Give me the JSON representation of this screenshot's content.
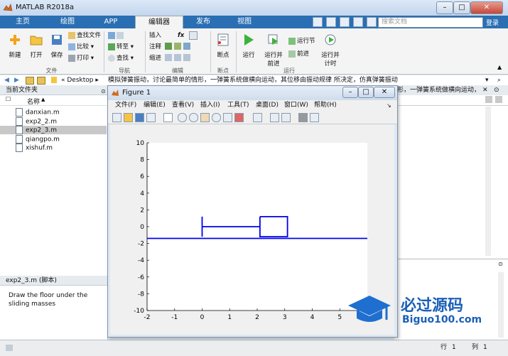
{
  "app": {
    "title": "MATLAB R2018a"
  },
  "tabs": [
    {
      "label": "主页"
    },
    {
      "label": "绘图"
    },
    {
      "label": "APP"
    },
    {
      "label": "编辑器"
    },
    {
      "label": "发布"
    },
    {
      "label": "视图"
    }
  ],
  "search": {
    "placeholder": "搜索文档"
  },
  "signin": "登录",
  "ribbon": {
    "file": {
      "new": "新建",
      "open": "打开",
      "save": "保存",
      "find_files": "查找文件",
      "compare": "比较",
      "print": "打印",
      "group": "文件"
    },
    "nav": {
      "goto": "转至",
      "find": "查找",
      "group": "导航"
    },
    "edit": {
      "insert": "插入",
      "comment": "注释",
      "indent": "缩进",
      "fx": "fx",
      "group": "编辑"
    },
    "breakpoints": {
      "label": "断点",
      "group": "断点"
    },
    "run": {
      "run": "运行",
      "run_advance_1": "运行并",
      "run_advance_2": "前进",
      "run_section": "运行节",
      "advance": "前进",
      "run_time_1": "运行并",
      "run_time_2": "计时",
      "group": "运行"
    }
  },
  "pathbar": {
    "desktop": "Desktop",
    "path": "模拟弹簧振动，讨论最简单的情形，一弹簧系统做横向运动，其位移由振动规律 所决定，仿真弹簧振动",
    "path_tail": "形，一弹簧系统做横向运动，"
  },
  "current_folder": {
    "header": "当前文件夹",
    "name_col": "名称",
    "files": [
      "danxian.m",
      "exp2_2.m",
      "exp2_3.m",
      "qiangpo.m",
      "xishuf.m"
    ],
    "selected_index": 2
  },
  "details": {
    "header": "exp2_3.m  (脚本)",
    "description": "Draw the floor under the sliding masses"
  },
  "status": {
    "row_label": "行",
    "row": "1",
    "col_label": "列",
    "col": "1"
  },
  "figure": {
    "title": "Figure 1",
    "menu": [
      "文件(F)",
      "编辑(E)",
      "查看(V)",
      "插入(I)",
      "工具(T)",
      "桌面(D)",
      "窗口(W)",
      "帮助(H)"
    ]
  },
  "chart_data": {
    "type": "line",
    "xlim": [
      -2,
      6
    ],
    "ylim": [
      -10,
      10
    ],
    "xticks": [
      -2,
      -1,
      0,
      1,
      2,
      3,
      4,
      5
    ],
    "yticks": [
      -10,
      -8,
      -6,
      -4,
      -2,
      0,
      2,
      4,
      6,
      8,
      10
    ],
    "series": [
      {
        "points": [
          [
            -2,
            -1.4
          ],
          [
            6,
            -1.4
          ]
        ]
      },
      {
        "points": [
          [
            0,
            1.2
          ],
          [
            0,
            -1.2
          ]
        ]
      },
      {
        "points": [
          [
            0,
            0
          ],
          [
            2.1,
            0
          ]
        ]
      },
      {
        "points": [
          [
            2.1,
            1.2
          ],
          [
            3.1,
            1.2
          ],
          [
            3.1,
            -1.2
          ],
          [
            2.1,
            -1.2
          ],
          [
            2.1,
            1.2
          ]
        ]
      }
    ],
    "line_color": "#0000ee"
  },
  "watermark": {
    "brand": "必过源码",
    "url": "Biguo100.com"
  }
}
